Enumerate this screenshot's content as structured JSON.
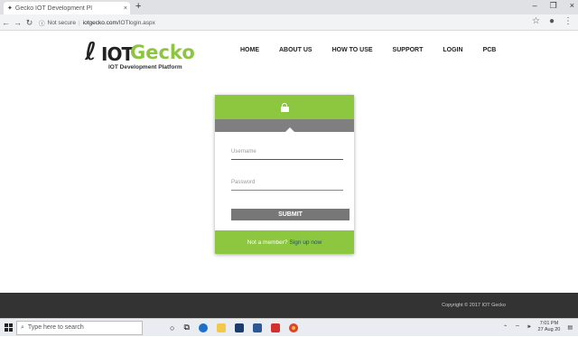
{
  "browser": {
    "tab_title": "Gecko IOT Development Pl",
    "tab_close": "×",
    "new_tab": "+",
    "window_controls": [
      "–",
      "❐",
      "×"
    ],
    "url_security": "Not secure",
    "url_domain": "iotgecko.com",
    "url_path": "/IOTlogin.aspx",
    "star": "☆"
  },
  "header": {
    "logo_iot": "IOT",
    "logo_gecko": "Gecko",
    "logo_tagline": "IOT Development Platform",
    "menu": [
      "HOME",
      "ABOUT US",
      "HOW TO USE",
      "SUPPORT",
      "LOGIN",
      "PCB"
    ]
  },
  "login": {
    "username_placeholder": "Username",
    "password_placeholder": "Password",
    "submit_label": "SUBMIT",
    "not_member": "Not a member?",
    "signup": "Sign up now"
  },
  "footer": {
    "copyright": "Copyright © 2017 IOT Gecko"
  },
  "taskbar": {
    "search_placeholder": "Type here to search",
    "time": "7:01 PM",
    "date": "27 Aug 20"
  },
  "colors": {
    "accent_green": "#8dc63f",
    "bar_gray": "#7f7f7f",
    "footer_dark": "#333333"
  }
}
